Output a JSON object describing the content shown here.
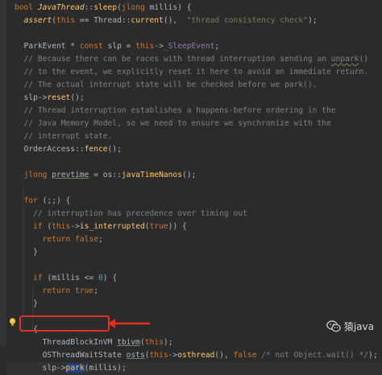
{
  "editor": {
    "lines": [
      {
        "id": "l1",
        "html": "<span class=\"kw\">bool</span> <span class=\"fn italic\">JavaThread</span>::<span class=\"fn\">sleep</span>(<span class=\"kw\">jlong</span> millis) {"
      },
      {
        "id": "l2",
        "html": "  <span class=\"fn italic\">assert</span>(<span class=\"kw\">this</span> == Thread::<span class=\"fn\">current</span>(),  <span class=\"str\">\"thread consistency check\"</span>);"
      },
      {
        "id": "l3",
        "html": ""
      },
      {
        "id": "l4",
        "html": "  ParkEvent * <span class=\"kw\">const</span> slp = <span class=\"kw\">this</span>-><span class=\"field\">_SleepEvent</span>;"
      },
      {
        "id": "l5",
        "html": "  <span class=\"cmt\">// Because there can be races with thread interruption sending an <span class=\"typo\">unpark</span>()</span>"
      },
      {
        "id": "l6",
        "html": "  <span class=\"cmt\">// to the event, we explicitly reset it here to avoid an immediate return.</span>"
      },
      {
        "id": "l7",
        "html": "  <span class=\"cmt\">// The actual interrupt state will be checked before we park().</span>"
      },
      {
        "id": "l8",
        "html": "  slp-><span class=\"fn\">reset</span>();"
      },
      {
        "id": "l9",
        "html": "  <span class=\"cmt\">// Thread interruption establishes a happens-before ordering in the</span>"
      },
      {
        "id": "l10",
        "html": "  <span class=\"cmt\">// Java Memory Model, so we need to ensure we synchronize with the</span>"
      },
      {
        "id": "l11",
        "html": "  <span class=\"cmt\">// interrupt state.</span>"
      },
      {
        "id": "l12",
        "html": "  OrderAccess::<span class=\"fn\">fence</span>();"
      },
      {
        "id": "l13",
        "html": ""
      },
      {
        "id": "l14",
        "html": "  <span class=\"kw\">jlong</span> <span class=\"under\">prevtime</span> = os::<span class=\"fn\">javaTimeNanos</span>();"
      },
      {
        "id": "l15",
        "html": ""
      },
      {
        "id": "l16",
        "html": "  <span class=\"kw\">for</span> (;;) {"
      },
      {
        "id": "l17",
        "html": "    <span class=\"cmt\">// interruption has precedence over timing out</span>"
      },
      {
        "id": "l18",
        "html": "    <span class=\"kw\">if</span> (<span class=\"kw\">this</span>-><span class=\"fn\">is_interrupted</span>(<span class=\"kw\">true</span>)) {"
      },
      {
        "id": "l19",
        "html": "      <span class=\"kw\">return false</span>;"
      },
      {
        "id": "l20",
        "html": "    }"
      },
      {
        "id": "l21",
        "html": ""
      },
      {
        "id": "l22",
        "html": "    <span class=\"kw\">if</span> (millis <= <span class=\"num\">0</span>) {"
      },
      {
        "id": "l23",
        "html": "      <span class=\"kw\">return true</span>;"
      },
      {
        "id": "l24",
        "html": "    }"
      },
      {
        "id": "l25",
        "html": ""
      },
      {
        "id": "l26",
        "html": "    {"
      },
      {
        "id": "l27",
        "html": "      ThreadBlockInVM <span class=\"under\">tbivm</span>(<span class=\"kw\">this</span>);"
      },
      {
        "id": "l28",
        "html": "      OSThreadWaitState <span class=\"under\">osts</span>(<span class=\"kw\">this</span>-><span class=\"fn\">osthread</span>(), <span class=\"kw\">false</span> <span class=\"cmt\">/* not Object.wait() */</span>);"
      },
      {
        "id": "l29",
        "html": "      slp-><span class=\"fn sel\">park</span>(millis);"
      }
    ]
  },
  "watermark": {
    "text": "猿java"
  },
  "colors": {
    "annotation": "#e0321f",
    "selection": "#214283",
    "background": "#2b2b2b"
  },
  "icons": {
    "gutter": "lightbulb-icon",
    "watermark": "wechat-icon"
  }
}
